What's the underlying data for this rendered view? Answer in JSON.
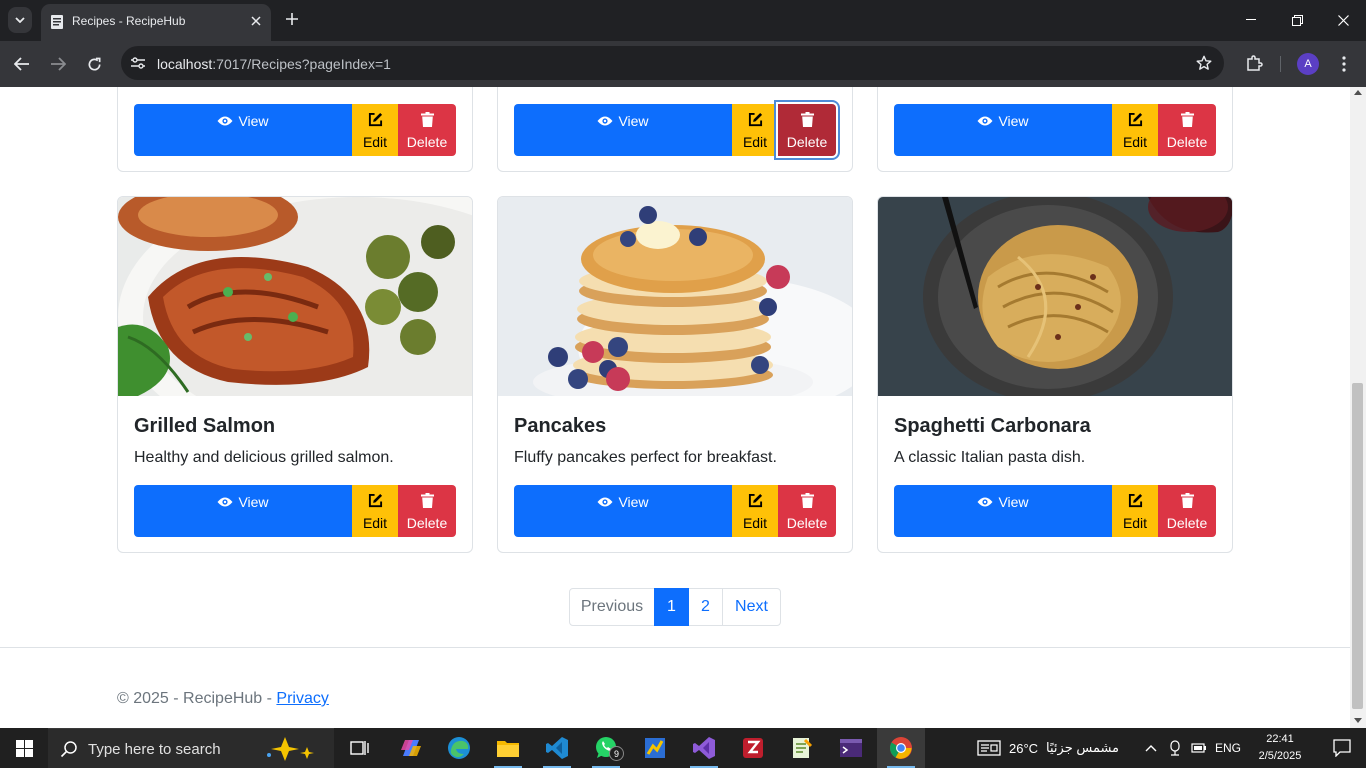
{
  "browser": {
    "tab_title": "Recipes - RecipeHub",
    "url_host": "localhost",
    "url_path": ":7017/Recipes?pageIndex=1",
    "profile_initial": "A"
  },
  "page": {
    "view_label": "View",
    "edit_label": "Edit",
    "delete_label": "Delete",
    "recipes": [
      {
        "title": "Grilled Salmon",
        "description": "Healthy and delicious grilled salmon."
      },
      {
        "title": "Pancakes",
        "description": "Fluffy pancakes perfect for breakfast."
      },
      {
        "title": "Spaghetti Carbonara",
        "description": "A classic Italian pasta dish."
      }
    ],
    "pagination": {
      "previous": "Previous",
      "pages": [
        "1",
        "2"
      ],
      "active_page": "1",
      "next": "Next"
    },
    "footer": {
      "copyright": "© 2025 - RecipeHub - ",
      "privacy_link": "Privacy"
    }
  },
  "taskbar": {
    "search_placeholder": "Type here to search",
    "whatsapp_badge": "9",
    "weather_temp": "26°C",
    "weather_text": "مشمس جزئيًا",
    "language": "ENG",
    "time": "22:41",
    "date": "2/5/2025"
  },
  "colors": {
    "primary": "#0d6efd",
    "warning": "#ffc107",
    "danger": "#dc3545"
  }
}
